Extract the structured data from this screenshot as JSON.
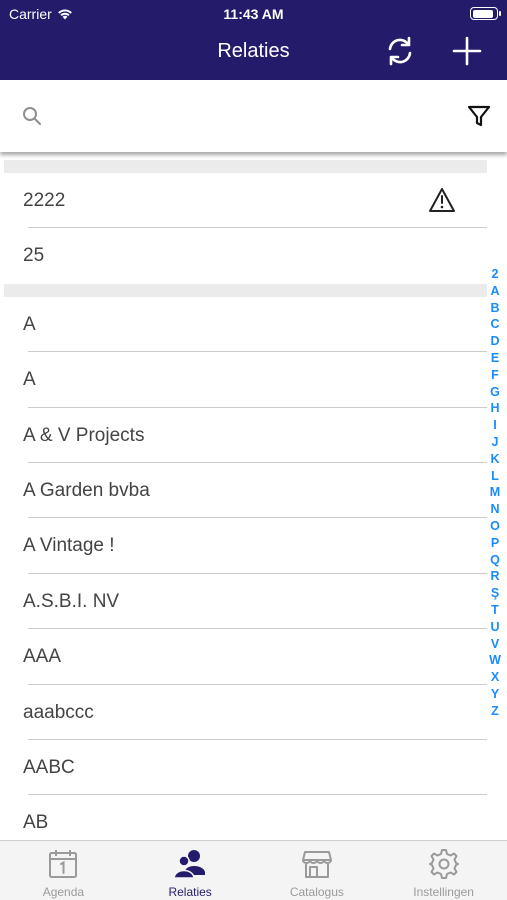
{
  "status_bar": {
    "carrier": "Carrier",
    "time": "11:43 AM",
    "battery_level": 0.92
  },
  "nav": {
    "title": "Relaties",
    "sync_icon": "sync-icon",
    "add_icon": "plus-icon"
  },
  "search": {
    "placeholder": "",
    "value": "",
    "filter_icon": "filter-icon"
  },
  "list": {
    "sections": [
      {
        "rows": [
          {
            "label": "2222",
            "warning": true
          },
          {
            "label": "25",
            "warning": false
          }
        ]
      },
      {
        "rows": [
          {
            "label": "A"
          },
          {
            "label": "A"
          },
          {
            "label": "A & V Projects"
          },
          {
            "label": "A Garden bvba"
          },
          {
            "label": "A Vintage !"
          },
          {
            "label": "A.S.B.I. NV"
          },
          {
            "label": "AAA"
          },
          {
            "label": "aaabccc"
          },
          {
            "label": "AABC"
          },
          {
            "label": "AB"
          }
        ]
      }
    ]
  },
  "index_letters": [
    "2",
    "A",
    "B",
    "C",
    "D",
    "E",
    "F",
    "G",
    "H",
    "I",
    "J",
    "K",
    "L",
    "M",
    "N",
    "O",
    "P",
    "Q",
    "R",
    "Ş",
    "T",
    "U",
    "V",
    "W",
    "X",
    "Y",
    "Z"
  ],
  "tabs": [
    {
      "label": "Agenda",
      "icon": "calendar-icon",
      "active": false
    },
    {
      "label": "Relaties",
      "icon": "people-icon",
      "active": true
    },
    {
      "label": "Catalogus",
      "icon": "store-icon",
      "active": false
    },
    {
      "label": "Instellingen",
      "icon": "gear-icon",
      "active": false
    }
  ],
  "colors": {
    "brand": "#241b6b",
    "index": "#1a8cff",
    "tab_inactive": "#9a9a9a"
  }
}
